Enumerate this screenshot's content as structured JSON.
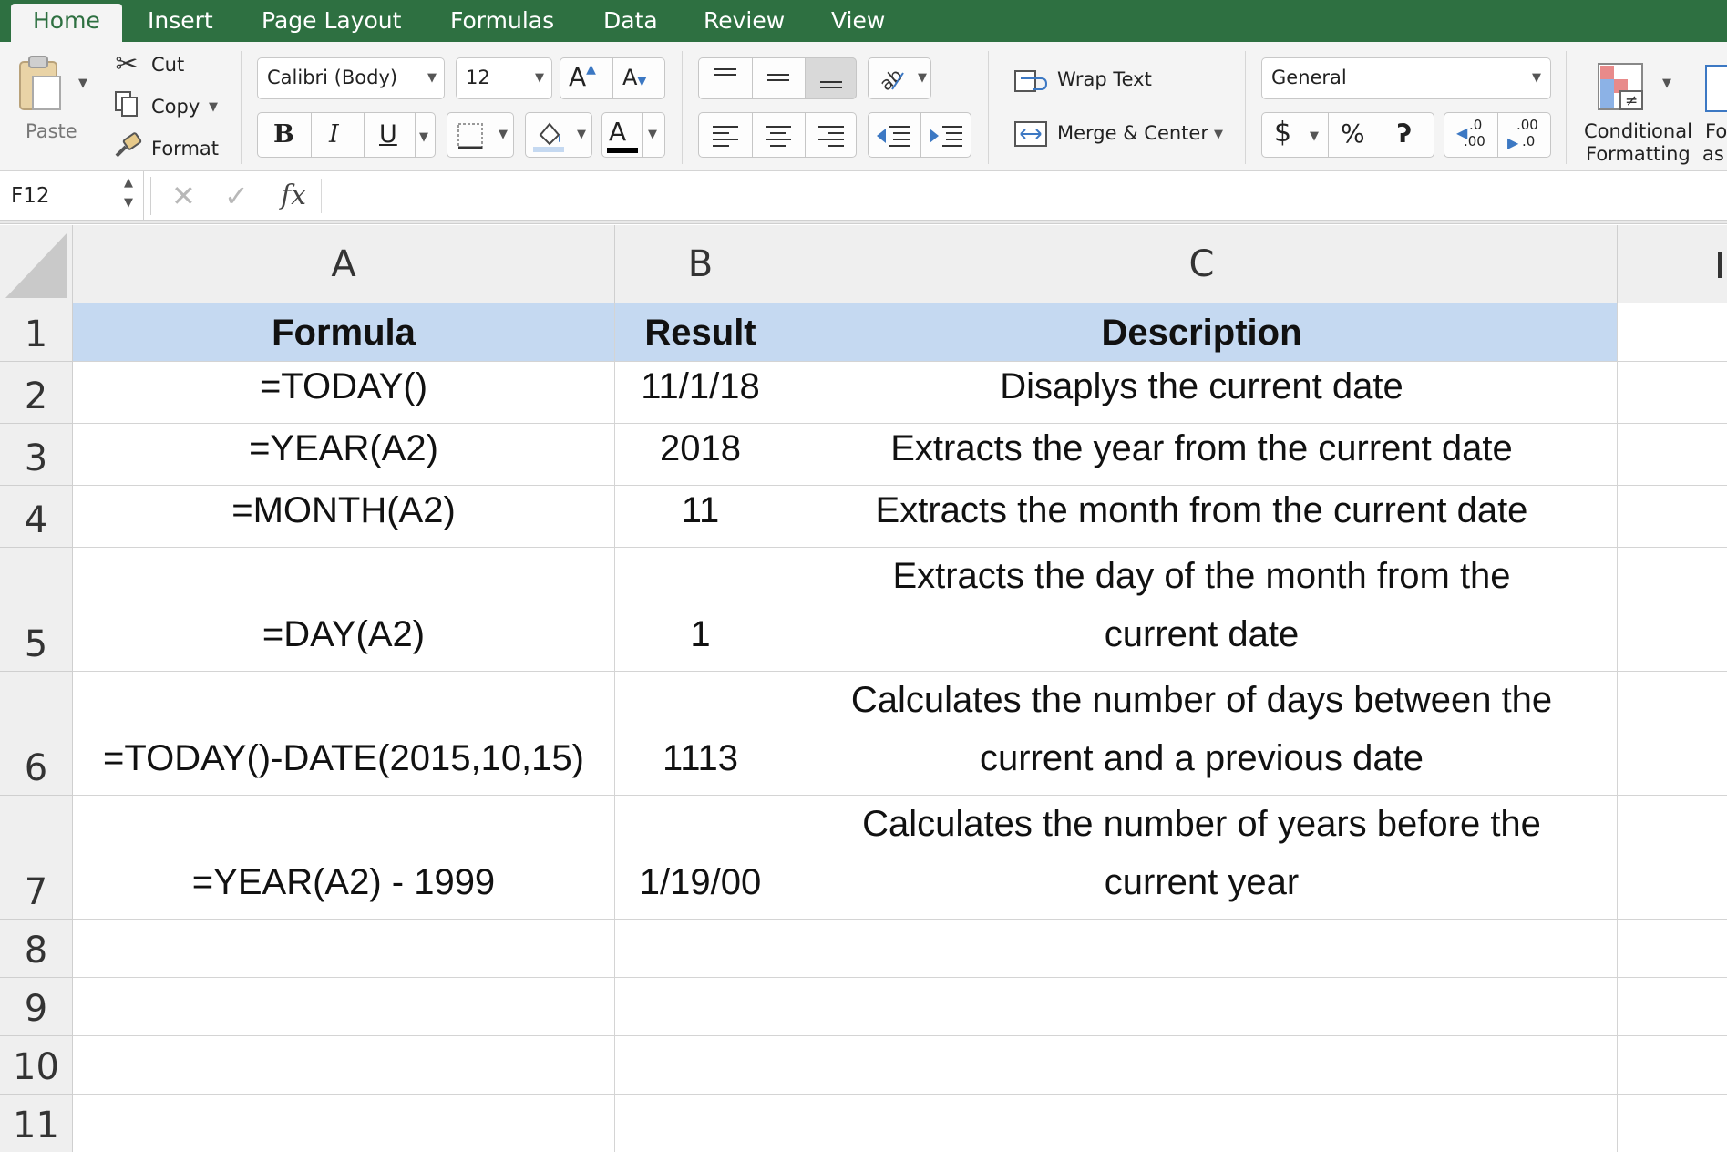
{
  "tabs": [
    "Home",
    "Insert",
    "Page Layout",
    "Formulas",
    "Data",
    "Review",
    "View"
  ],
  "clipboard": {
    "paste_label": "Paste",
    "cut_label": "Cut",
    "copy_label": "Copy",
    "format_label": "Format"
  },
  "font": {
    "family": "Calibri (Body)",
    "size": "12",
    "bold": "B",
    "italic": "I",
    "underline": "U",
    "grow": "A",
    "shrink": "A",
    "color_letter": "A"
  },
  "alignment": {
    "wrap_text": "Wrap Text",
    "merge_center": "Merge & Center"
  },
  "number": {
    "format": "General",
    "currency": "$",
    "percent": "%",
    "comma": "ʔ",
    "increase_decimal_top": ".0",
    "increase_decimal_bottom": ".00",
    "decrease_decimal_top": ".00",
    "decrease_decimal_bottom": ".0"
  },
  "styles": {
    "conditional_line1": "Conditional",
    "conditional_line2": "Formatting",
    "format_as_line1": "Fo",
    "format_as_line2": "as"
  },
  "formula_bar": {
    "name_box": "F12",
    "fx": "fx",
    "content": ""
  },
  "columns": [
    "A",
    "B",
    "C"
  ],
  "rows": [
    {
      "num": "1",
      "a": "Formula",
      "b": "Result",
      "c": "Description"
    },
    {
      "num": "2",
      "a": "=TODAY()",
      "b": "11/1/18",
      "c": "Disaplys the current date"
    },
    {
      "num": "3",
      "a": "=YEAR(A2)",
      "b": "2018",
      "c": "Extracts the year from the current date"
    },
    {
      "num": "4",
      "a": "=MONTH(A2)",
      "b": "11",
      "c": "Extracts the month from the current date"
    },
    {
      "num": "5",
      "a": "=DAY(A2)",
      "b": "1",
      "c": "Extracts the day of the month from the current date"
    },
    {
      "num": "6",
      "a": "=TODAY()-DATE(2015,10,15)",
      "b": "1113",
      "c": "Calculates the number of days between the current and a previous date"
    },
    {
      "num": "7",
      "a": "=YEAR(A2) - 1999",
      "b": "1/19/00",
      "c": "Calculates the number of years before the current year"
    },
    {
      "num": "8",
      "a": "",
      "b": "",
      "c": ""
    },
    {
      "num": "9",
      "a": "",
      "b": "",
      "c": ""
    },
    {
      "num": "10",
      "a": "",
      "b": "",
      "c": ""
    },
    {
      "num": "11",
      "a": "",
      "b": "",
      "c": ""
    }
  ],
  "colors": {
    "ribbon_green": "#2e7041",
    "header_fill": "#c5d9f1",
    "icon_blue": "#3c78c3"
  }
}
